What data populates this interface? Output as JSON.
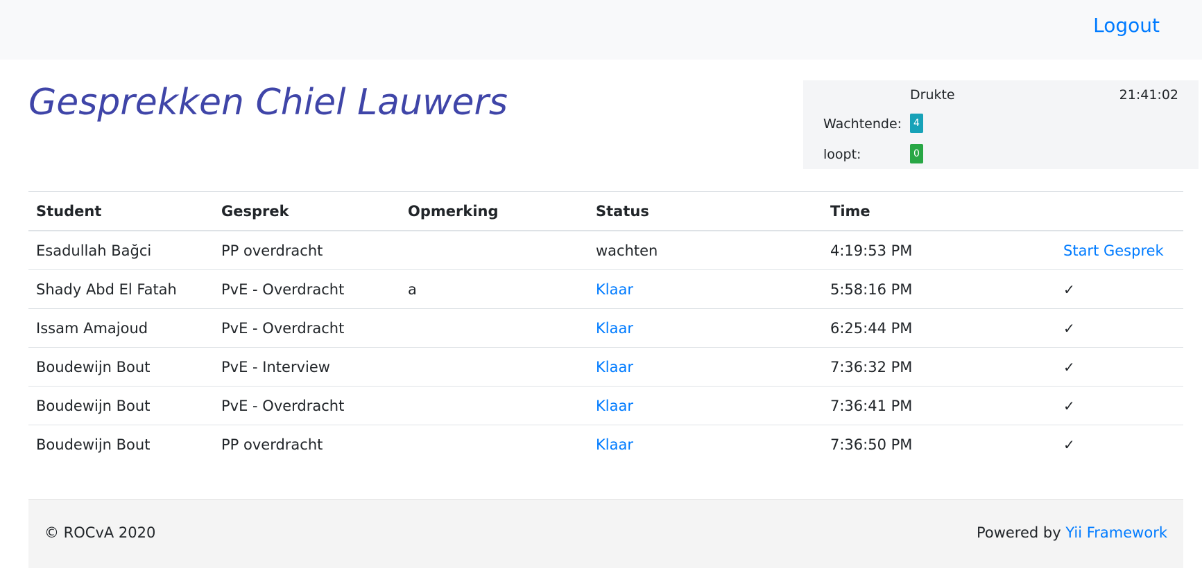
{
  "nav": {
    "logout_label": "Logout"
  },
  "page": {
    "title": "Gesprekken Chiel Lauwers"
  },
  "drukte": {
    "title": "Drukte",
    "clock": "21:41:02",
    "wachtende_label": "Wachtende:",
    "wachtende_count": "4",
    "loopt_label": "loopt:",
    "loopt_count": "0"
  },
  "table": {
    "headers": [
      "Student",
      "Gesprek",
      "Opmerking",
      "Status",
      "Time",
      ""
    ],
    "rows": [
      {
        "student": "Esadullah Bağci",
        "gesprek": "PP overdracht",
        "opmerking": "",
        "status": "wachten",
        "time": "4:19:53 PM",
        "action": "Start Gesprek"
      },
      {
        "student": "Shady Abd El Fatah",
        "gesprek": "PvE - Overdracht",
        "opmerking": "a",
        "status": "Klaar",
        "time": "5:58:16 PM",
        "action": "✓"
      },
      {
        "student": "Issam Amajoud",
        "gesprek": "PvE - Overdracht",
        "opmerking": "",
        "status": "Klaar",
        "time": "6:25:44 PM",
        "action": "✓"
      },
      {
        "student": "Boudewijn Bout",
        "gesprek": "PvE - Interview",
        "opmerking": "",
        "status": "Klaar",
        "time": "7:36:32 PM",
        "action": "✓"
      },
      {
        "student": "Boudewijn Bout",
        "gesprek": "PvE - Overdracht",
        "opmerking": "",
        "status": "Klaar",
        "time": "7:36:41 PM",
        "action": "✓"
      },
      {
        "student": "Boudewijn Bout",
        "gesprek": "PP overdracht",
        "opmerking": "",
        "status": "Klaar",
        "time": "7:36:50 PM",
        "action": "✓"
      }
    ]
  },
  "footer": {
    "copyright": "© ROCvA 2020",
    "powered_by": "Powered by ",
    "framework_link": "Yii Framework"
  },
  "colors": {
    "accent_link": "#007bff",
    "title": "#3f45a8",
    "badge_info": "#17a2b8",
    "badge_success": "#28a745"
  }
}
